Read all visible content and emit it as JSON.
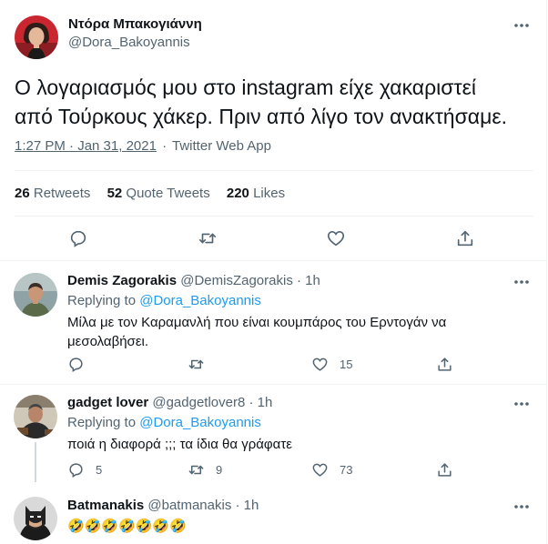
{
  "main_tweet": {
    "author_name": "Ντόρα Μπακογιάννη",
    "author_handle": "@Dora_Bakoyannis",
    "text_line1": "Ο λογαριασμός μου στο instagram είχε χακαριστεί",
    "text_line2": "από Τούρκους χάκερ. Πριν από λίγο τον ανακτήσαμε.",
    "timestamp": "1:27 PM · Jan 31, 2021",
    "separator": "·",
    "source": "Twitter Web App",
    "stats": {
      "retweets_count": "26",
      "retweets_label": "Retweets",
      "quotes_count": "52",
      "quotes_label": "Quote Tweets",
      "likes_count": "220",
      "likes_label": "Likes"
    },
    "actions": [
      "reply-icon",
      "retweet-icon",
      "like-icon",
      "share-icon"
    ]
  },
  "replies": [
    {
      "author_name": "Demis Zagorakis",
      "author_handle": "@DemisZagorakis",
      "time": "· 1h",
      "replying_prefix": "Replying to",
      "replying_to": "@Dora_Bakoyannis",
      "text_line1": "Μίλα με τον Καραμανλή που είναι κουμπάρος του Ερντογάν να",
      "text_line2": "μεσολαβήσει.",
      "reply_count": "",
      "retweet_count": "",
      "like_count": "15"
    },
    {
      "author_name": "gadget lover",
      "author_handle": "@gadgetlover8",
      "time": "· 1h",
      "replying_prefix": "Replying to",
      "replying_to": "@Dora_Bakoyannis",
      "text_line1": "ποιά η διαφορά ;;; τα ίδια θα γράφατε",
      "reply_count": "5",
      "retweet_count": "9",
      "like_count": "73"
    },
    {
      "author_name": "Batmanakis",
      "author_handle": "@batmanakis",
      "time": "· 1h",
      "text_line1": "🤣🤣🤣🤣🤣🤣🤣"
    }
  ],
  "colors": {
    "accent": "#1d9bf0",
    "text": "#0f1419",
    "muted": "#536471",
    "border": "#eff3f4"
  }
}
